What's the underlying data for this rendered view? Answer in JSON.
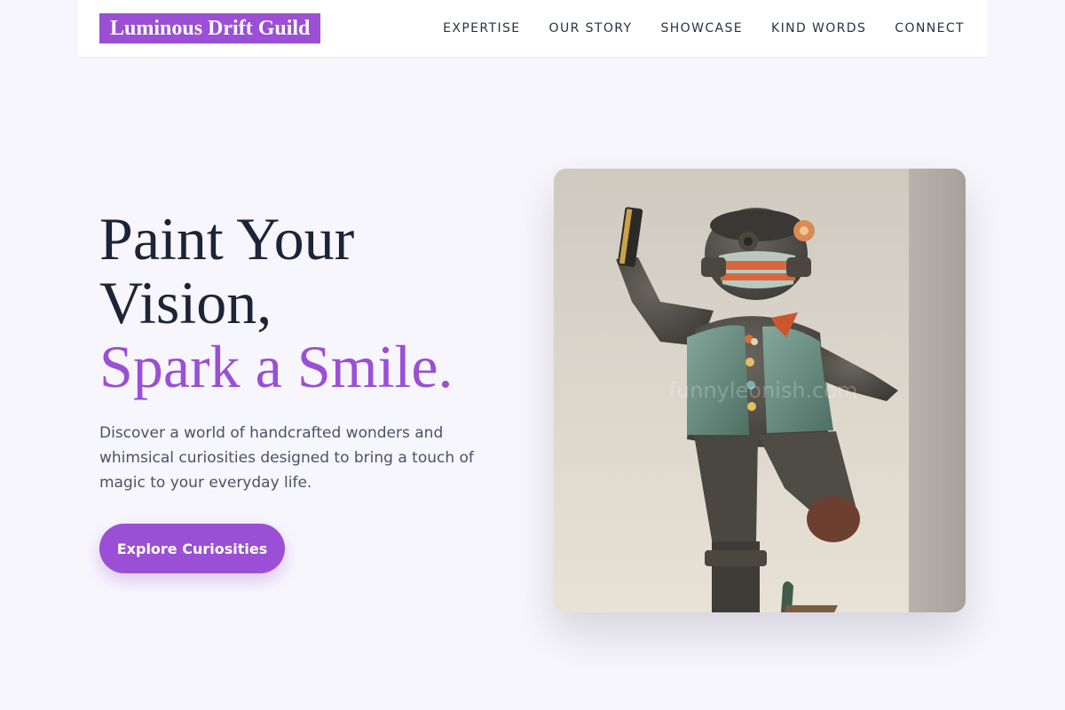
{
  "brand": {
    "name": "Luminous Drift Guild",
    "accent_color": "#9b4fd4"
  },
  "nav": {
    "items": [
      {
        "label": "EXPERTISE"
      },
      {
        "label": "OUR STORY"
      },
      {
        "label": "SHOWCASE"
      },
      {
        "label": "KIND WORDS"
      },
      {
        "label": "CONNECT"
      }
    ]
  },
  "hero": {
    "headline_line1": "Paint Your",
    "headline_line2": "Vision,",
    "headline_accent": "Spark a Smile.",
    "description": "Discover a world of handcrafted wonders and whimsical curiosities designed to bring a touch of magic to your everyday life.",
    "cta_label": "Explore Curiosities",
    "image": {
      "subject": "clay-figurine-photo",
      "watermark": "funnyleonish.com"
    }
  }
}
